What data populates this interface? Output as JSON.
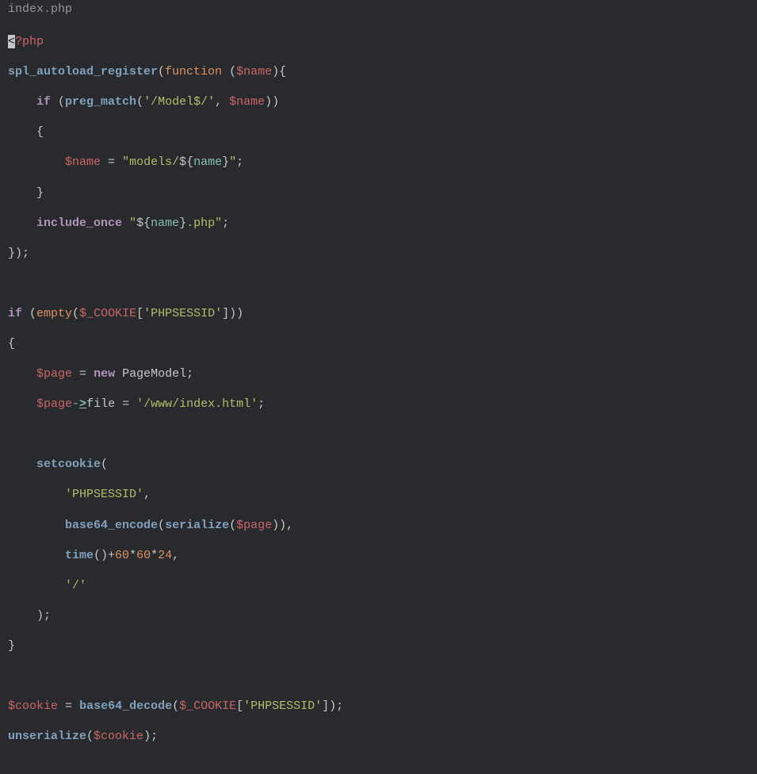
{
  "tab": {
    "filename": "index.php"
  },
  "code": {
    "l1": {
      "lt": "<",
      "phptag": "?php"
    },
    "l2": {
      "fn": "spl_autoload_register",
      "kw": "function",
      "var": "$name"
    },
    "l3": {
      "kw": "if",
      "fn": "preg_match",
      "re": "'/Model$/'",
      "var": "$name"
    },
    "l4": {
      "brace": "{"
    },
    "l5": {
      "var": "$name",
      "eq": "=",
      "s1": "\"models/",
      "intp": "${",
      "nm": "name",
      "ce": "}",
      "eq2": "\""
    },
    "l6": {
      "brace": "}"
    },
    "l7": {
      "kw": "include_once",
      "q": "\"",
      "intp": "${",
      "nm": "name",
      "ce": "}",
      "s2": ".php",
      "q2": "\""
    },
    "l8": {
      "close": "});"
    },
    "l9": {},
    "l10": {
      "kw": "if",
      "fn": "empty",
      "var": "$_COOKIE",
      "key": "'PHPSESSID'"
    },
    "l11": {
      "brace": "{"
    },
    "l12": {
      "var": "$page",
      "eq": "=",
      "kw": "new",
      "cls": "PageModel"
    },
    "l13": {
      "var": "$page",
      "ar": "-",
      "ar2": ">",
      "prop": "file",
      "eq": "=",
      "str": "'/www/index.html'"
    },
    "l14": {},
    "l15": {
      "fn": "setcookie"
    },
    "l16": {
      "str": "'PHPSESSID'"
    },
    "l17": {
      "fn1": "base64_encode",
      "fn2": "serialize",
      "var": "$page"
    },
    "l18": {
      "fn": "time",
      "n1": "60",
      "n2": "60",
      "n3": "24"
    },
    "l19": {
      "str": "'/'"
    },
    "l20": {
      "close": ");"
    },
    "l21": {
      "brace": "}"
    },
    "l22": {},
    "l23": {
      "var": "$cookie",
      "eq": "=",
      "fn": "base64_decode",
      "var2": "$_COOKIE",
      "key": "'PHPSESSID'"
    },
    "l24": {
      "fn": "unserialize",
      "var": "$cookie"
    }
  }
}
